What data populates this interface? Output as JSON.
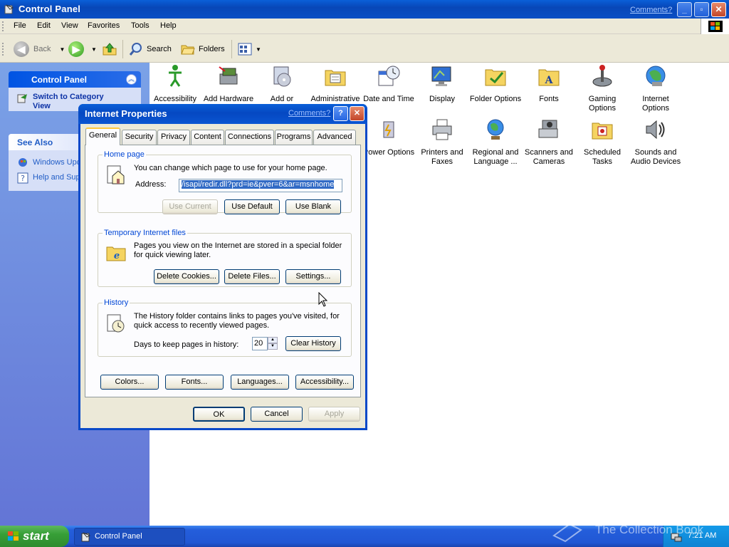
{
  "window": {
    "title": "Control Panel",
    "comments_link": "Comments?"
  },
  "menubar": [
    "File",
    "Edit",
    "View",
    "Favorites",
    "Tools",
    "Help"
  ],
  "toolbar": {
    "back": "Back",
    "search": "Search",
    "folders": "Folders"
  },
  "taskpane": {
    "control_panel_title": "Control Panel",
    "switch_link": "Switch to Category View",
    "see_also_title": "See Also",
    "see_also_items": [
      "Windows Upd",
      "Help and Sup"
    ]
  },
  "icons": [
    {
      "label": "Accessibility Options",
      "icon": "accessibility-icon"
    },
    {
      "label": "Add Hardware",
      "icon": "add-hardware-icon"
    },
    {
      "label": "Add or Remov...",
      "icon": "add-remove-programs-icon"
    },
    {
      "label": "Administrative Tools",
      "icon": "administrative-tools-icon"
    },
    {
      "label": "Date and Time",
      "icon": "date-time-icon"
    },
    {
      "label": "Display",
      "icon": "display-icon"
    },
    {
      "label": "Folder Options",
      "icon": "folder-options-icon"
    },
    {
      "label": "Fonts",
      "icon": "fonts-icon"
    },
    {
      "label": "Gaming Options",
      "icon": "gaming-options-icon"
    },
    {
      "label": "Internet Options",
      "icon": "internet-options-icon"
    },
    {
      "label": "Power Options",
      "icon": "power-options-icon"
    },
    {
      "label": "Printers and Faxes",
      "icon": "printers-faxes-icon"
    },
    {
      "label": "Regional and Language ...",
      "icon": "regional-language-icon"
    },
    {
      "label": "Scanners and Cameras",
      "icon": "scanners-cameras-icon"
    },
    {
      "label": "Scheduled Tasks",
      "icon": "scheduled-tasks-icon"
    },
    {
      "label": "Sounds and Audio Devices",
      "icon": "sounds-audio-icon"
    }
  ],
  "dialog": {
    "title": "Internet Properties",
    "comments_link": "Comments?",
    "help_glyph": "?",
    "close_glyph": "✕",
    "tabs": [
      "General",
      "Security",
      "Privacy",
      "Content",
      "Connections",
      "Programs",
      "Advanced"
    ],
    "active_tab": "General",
    "home_page": {
      "legend": "Home page",
      "description": "You can change which page to use for your home page.",
      "address_label": "Address:",
      "address_value": "/isapi/redir.dll?prd=ie&pver=6&ar=msnhome",
      "use_current": "Use Current",
      "use_default": "Use Default",
      "use_blank": "Use Blank"
    },
    "temp_files": {
      "legend": "Temporary Internet files",
      "description": "Pages you view on the Internet are stored in a special folder for quick viewing later.",
      "delete_cookies": "Delete Cookies...",
      "delete_files": "Delete Files...",
      "settings": "Settings..."
    },
    "history": {
      "legend": "History",
      "description": "The History folder contains links to pages you've visited, for quick access to recently viewed pages.",
      "days_label": "Days to keep pages in history:",
      "days_value": "20",
      "clear_history": "Clear History"
    },
    "bottom_buttons": [
      "Colors...",
      "Fonts...",
      "Languages...",
      "Accessibility..."
    ],
    "ok": "OK",
    "cancel": "Cancel",
    "apply": "Apply"
  },
  "taskbar": {
    "start": "start",
    "task_button": "Control Panel",
    "clock": "7:21 AM"
  },
  "watermark": "The Collection Book",
  "colors": {
    "xp_blue": "#0a49c8",
    "taskpane_blue": "#6f8ee0",
    "start_green": "#379f37",
    "selection": "#316ac5"
  }
}
